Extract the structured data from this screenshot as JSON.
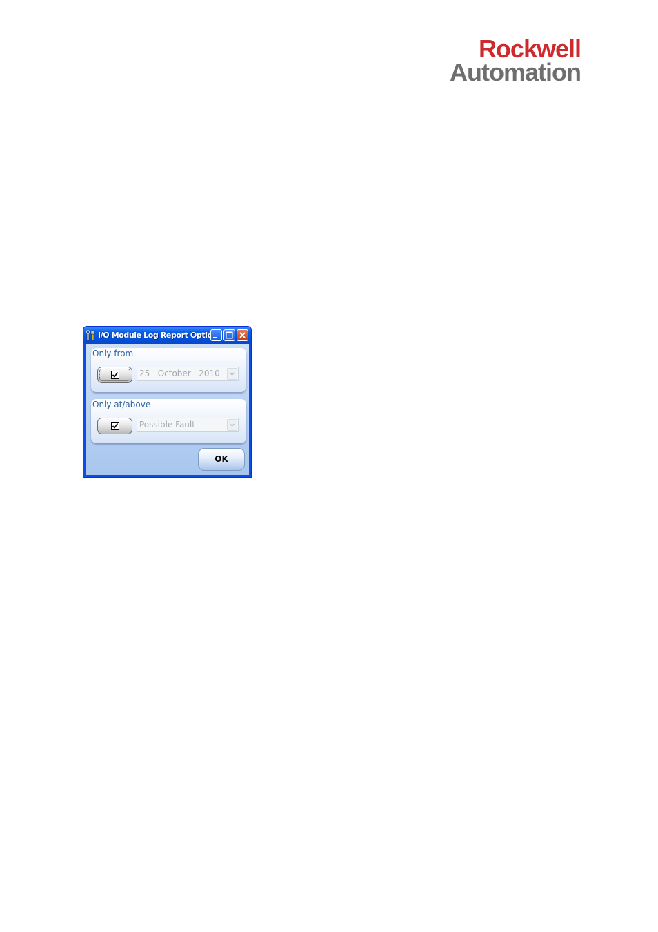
{
  "logo": {
    "line1": "Rockwell",
    "line2": "Automation"
  },
  "dialog": {
    "title": "I/O Module Log Report Options",
    "icon": "tools-icon",
    "window_buttons": [
      "minimize-icon",
      "maximize-icon",
      "close-icon"
    ],
    "groups": [
      {
        "label": "Only from",
        "checked": true,
        "combo_value": "25   October   2010"
      },
      {
        "label": "Only at/above",
        "checked": true,
        "combo_value": "Possible Fault"
      }
    ],
    "ok_label": "OK"
  },
  "colors": {
    "logo_red": "#cd2a2e",
    "logo_gray": "#6e6e6e",
    "titlebar_blue": "#0150dc",
    "close_red": "#c73a12"
  }
}
